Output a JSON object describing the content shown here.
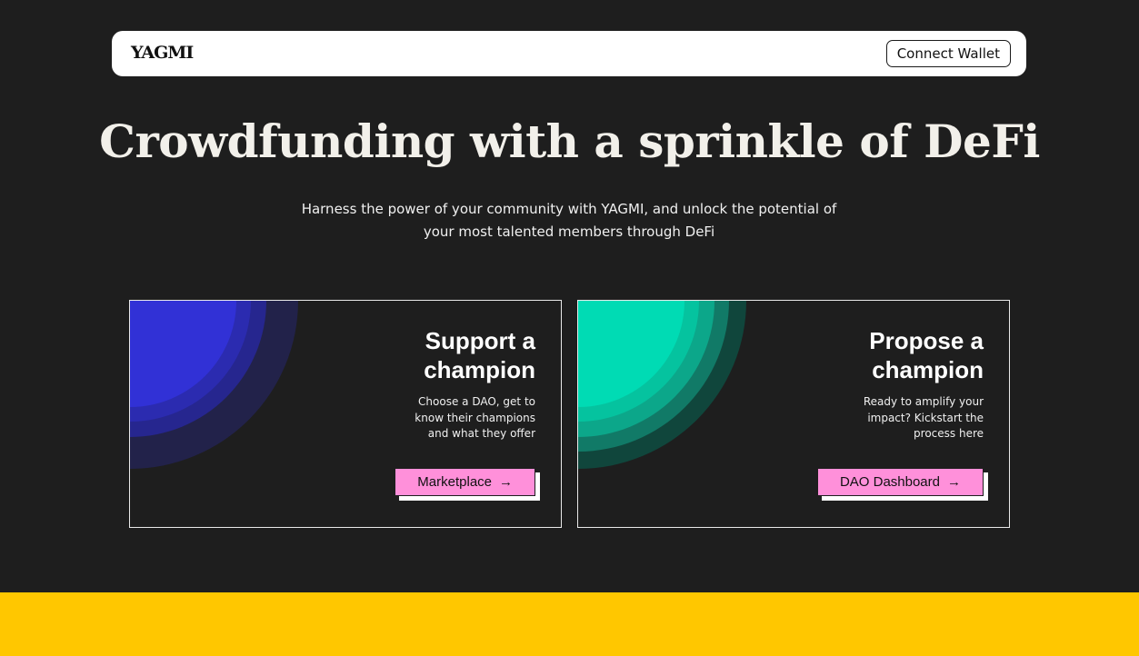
{
  "header": {
    "logo": "YAGMI",
    "connect_label": "Connect Wallet"
  },
  "hero": {
    "title": "Crowdfunding with a sprinkle of DeFi",
    "subtitle": "Harness the power of your community with YAGMI, and unlock the potential of your most talented members through DeFi"
  },
  "cards": [
    {
      "title": "Support a champion",
      "description": "Choose a DAO, get to know their champions and what they offer",
      "button_label": "Marketplace",
      "button_icon": "arrow-right-icon",
      "accent_color": "#3131d6"
    },
    {
      "title": "Propose a champion",
      "description": "Ready to amplify your impact? Kickstart the process here",
      "button_label": "DAO Dashboard",
      "button_icon": "arrow-right-icon",
      "accent_color": "#00dbb4"
    }
  ],
  "colors": {
    "background": "#1e1e1e",
    "button_pink": "#ff90da",
    "footer_yellow": "#ffc700"
  }
}
